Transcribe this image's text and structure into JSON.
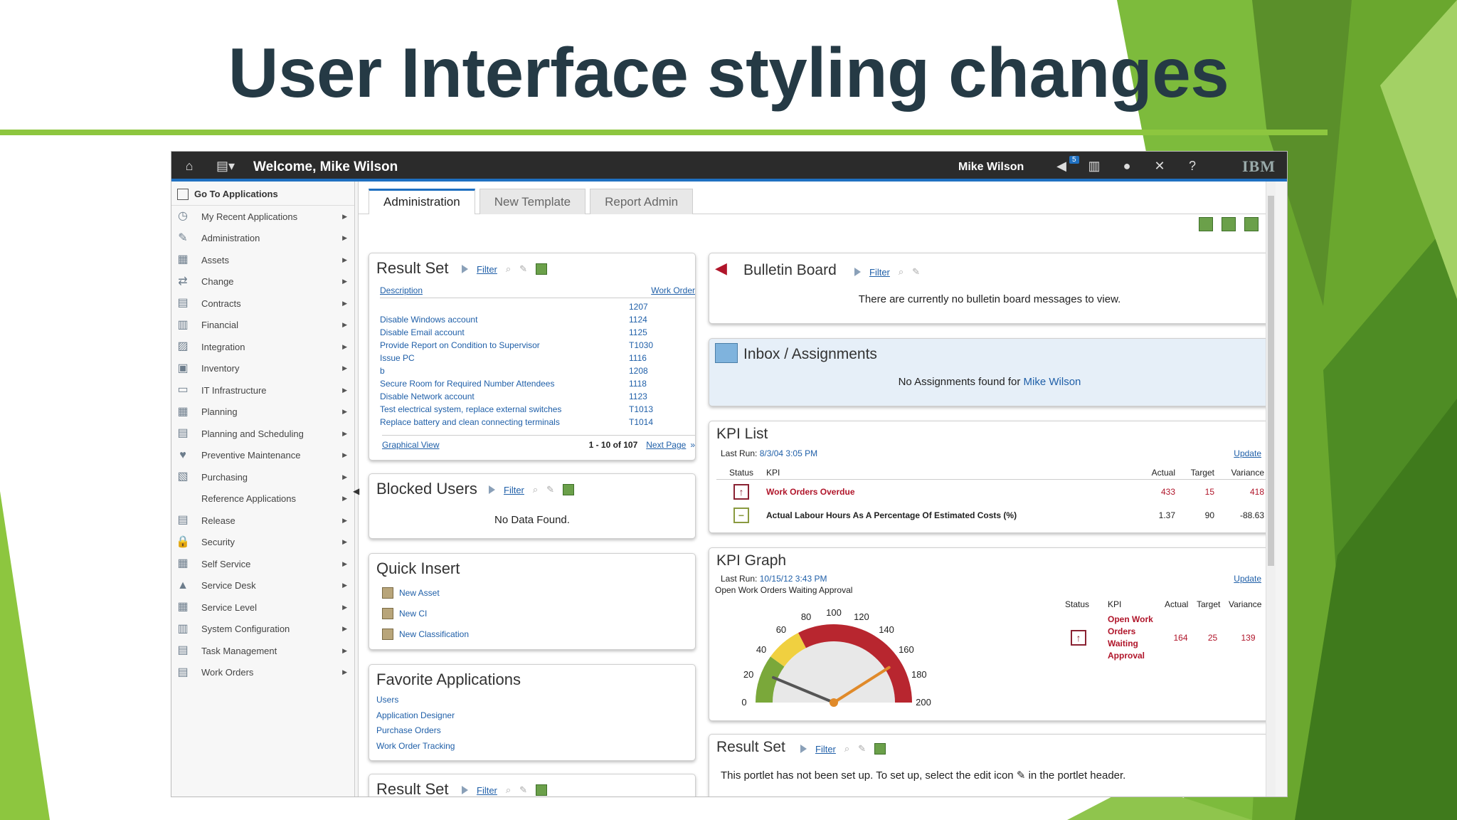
{
  "slide": {
    "title": "User Interface styling changes"
  },
  "topbar": {
    "welcome": "Welcome, Mike Wilson",
    "user_name": "Mike Wilson",
    "notification_count": "5",
    "brand": "IBM",
    "icons": [
      "home-icon",
      "apps-menu-icon",
      "megaphone-icon",
      "chart-icon",
      "user-icon",
      "close-icon",
      "help-icon"
    ]
  },
  "sidebar": {
    "goto_label": "Go To Applications",
    "items": [
      {
        "label": "My Recent Applications",
        "icon": "recent-apps-icon"
      },
      {
        "label": "Administration",
        "icon": "administration-icon"
      },
      {
        "label": "Assets",
        "icon": "assets-icon"
      },
      {
        "label": "Change",
        "icon": "change-icon"
      },
      {
        "label": "Contracts",
        "icon": "contracts-icon"
      },
      {
        "label": "Financial",
        "icon": "financial-icon"
      },
      {
        "label": "Integration",
        "icon": "integration-icon"
      },
      {
        "label": "Inventory",
        "icon": "inventory-icon"
      },
      {
        "label": "IT Infrastructure",
        "icon": "it-infrastructure-icon"
      },
      {
        "label": "Planning",
        "icon": "planning-icon"
      },
      {
        "label": "Planning and Scheduling",
        "icon": "scheduling-icon"
      },
      {
        "label": "Preventive Maintenance",
        "icon": "maintenance-icon"
      },
      {
        "label": "Purchasing",
        "icon": "purchasing-icon"
      },
      {
        "label": "Reference Applications",
        "icon": ""
      },
      {
        "label": "Release",
        "icon": "release-icon"
      },
      {
        "label": "Security",
        "icon": "lock-icon"
      },
      {
        "label": "Self Service",
        "icon": "self-service-icon"
      },
      {
        "label": "Service Desk",
        "icon": "service-desk-icon"
      },
      {
        "label": "Service Level",
        "icon": "service-level-icon"
      },
      {
        "label": "System Configuration",
        "icon": "system-config-icon"
      },
      {
        "label": "Task Management",
        "icon": "task-icon"
      },
      {
        "label": "Work Orders",
        "icon": "work-orders-icon"
      }
    ]
  },
  "tabs": [
    {
      "label": "Administration",
      "active": true
    },
    {
      "label": "New Template",
      "active": false
    },
    {
      "label": "Report Admin",
      "active": false
    }
  ],
  "result_set": {
    "title": "Result Set",
    "filter": "Filter",
    "col_description": "Description",
    "col_work_order": "Work Order",
    "rows": [
      {
        "desc": "",
        "wo": "1207"
      },
      {
        "desc": "Disable Windows account",
        "wo": "1124"
      },
      {
        "desc": "Disable Email account",
        "wo": "1125"
      },
      {
        "desc": "Provide Report on Condition to Supervisor",
        "wo": "T1030"
      },
      {
        "desc": "Issue PC",
        "wo": "1116"
      },
      {
        "desc": "b",
        "wo": "1208"
      },
      {
        "desc": "Secure Room for Required Number Attendees",
        "wo": "1118"
      },
      {
        "desc": "Disable Network account",
        "wo": "1123"
      },
      {
        "desc": "Test electrical system, replace external switches",
        "wo": "T1013"
      },
      {
        "desc": "Replace battery and clean connecting terminals",
        "wo": "T1014"
      }
    ],
    "graphical_view": "Graphical View",
    "count": "1 - 10 of 107",
    "next_page": "Next Page"
  },
  "blocked_users": {
    "title": "Blocked Users",
    "filter": "Filter",
    "message": "No Data Found."
  },
  "quick_insert": {
    "title": "Quick Insert",
    "items": [
      "New Asset",
      "New CI",
      "New Classification"
    ]
  },
  "favorites": {
    "title": "Favorite Applications",
    "items": [
      "Users",
      "Application Designer",
      "Purchase Orders",
      "Work Order Tracking"
    ]
  },
  "result_set_2": {
    "title": "Result Set",
    "filter": "Filter"
  },
  "bulletin": {
    "title": "Bulletin Board",
    "filter": "Filter",
    "message": "There are currently no bulletin board messages to view."
  },
  "inbox": {
    "title": "Inbox / Assignments",
    "message": "No Assignments found for",
    "user": "Mike Wilson"
  },
  "kpi_list": {
    "title": "KPI List",
    "last_run_label": "Last Run:",
    "last_run": "8/3/04 3:05 PM",
    "update": "Update",
    "headers": {
      "status": "Status",
      "kpi": "KPI",
      "actual": "Actual",
      "target": "Target",
      "variance": "Variance"
    },
    "rows": [
      {
        "status": "up",
        "kpi": "Work Orders Overdue",
        "actual": "433",
        "target": "15",
        "variance": "418",
        "alert": true
      },
      {
        "status": "ok",
        "kpi": "Actual Labour Hours As A Percentage Of Estimated Costs (%)",
        "actual": "1.37",
        "target": "90",
        "variance": "-88.63",
        "alert": false
      }
    ]
  },
  "kpi_graph": {
    "title": "KPI Graph",
    "last_run_label": "Last Run:",
    "last_run": "10/15/12 3:43 PM",
    "update": "Update",
    "caption": "Open Work Orders Waiting Approval",
    "gauge_ticks": [
      "0",
      "20",
      "40",
      "60",
      "80",
      "100",
      "120",
      "140",
      "160",
      "180",
      "200"
    ],
    "gauge_min": 0,
    "gauge_max": 200,
    "actual_value": 164,
    "target_value": 25,
    "headers": {
      "status": "Status",
      "kpi": "KPI",
      "actual": "Actual",
      "target": "Target",
      "variance": "Variance"
    },
    "row": {
      "kpi": "Open Work Orders Waiting Approval",
      "actual": "164",
      "target": "25",
      "variance": "139"
    }
  },
  "result_set_3": {
    "title": "Result Set",
    "filter": "Filter",
    "message": "This portlet has not been set up. To set up, select the edit icon",
    "message_tail": "in the portlet header."
  }
}
